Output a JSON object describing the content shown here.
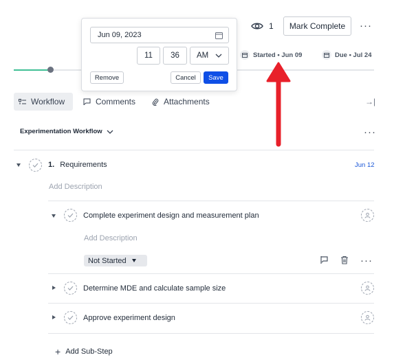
{
  "header": {
    "watchers_count": "1",
    "mark_complete_label": "Mark Complete",
    "more_label": "···",
    "started_label": "Started • Jun 09",
    "due_label": "Due • Jul 24",
    "progress_fraction": 0.1
  },
  "date_picker": {
    "date_value": "Jun 09, 2023",
    "hour": "11",
    "minute": "36",
    "meridiem": "AM",
    "remove_label": "Remove",
    "cancel_label": "Cancel",
    "save_label": "Save"
  },
  "tabs": [
    {
      "label": "Workflow",
      "icon": "workflow-icon",
      "active": true
    },
    {
      "label": "Comments",
      "icon": "comment-icon",
      "active": false
    },
    {
      "label": "Attachments",
      "icon": "paperclip-icon",
      "active": false
    }
  ],
  "workflow": {
    "title": "Experimentation Workflow",
    "more_label": "···",
    "step": {
      "number": "1.",
      "title": "Requirements",
      "due": "Jun 12",
      "description_placeholder": "Add Description",
      "substeps": [
        {
          "title": "Complete experiment design and measurement plan",
          "expanded": true,
          "description_placeholder": "Add Description",
          "status": "Not Started"
        },
        {
          "title": "Determine MDE and calculate sample size",
          "expanded": false
        },
        {
          "title": "Approve experiment design",
          "expanded": false
        }
      ],
      "add_substep_label": "Add Sub-Step"
    }
  },
  "colors": {
    "accent": "#0f4fe6",
    "progress": "#3fbf95",
    "annotation_arrow": "#e8202a",
    "due_text": "#1b57d8"
  }
}
